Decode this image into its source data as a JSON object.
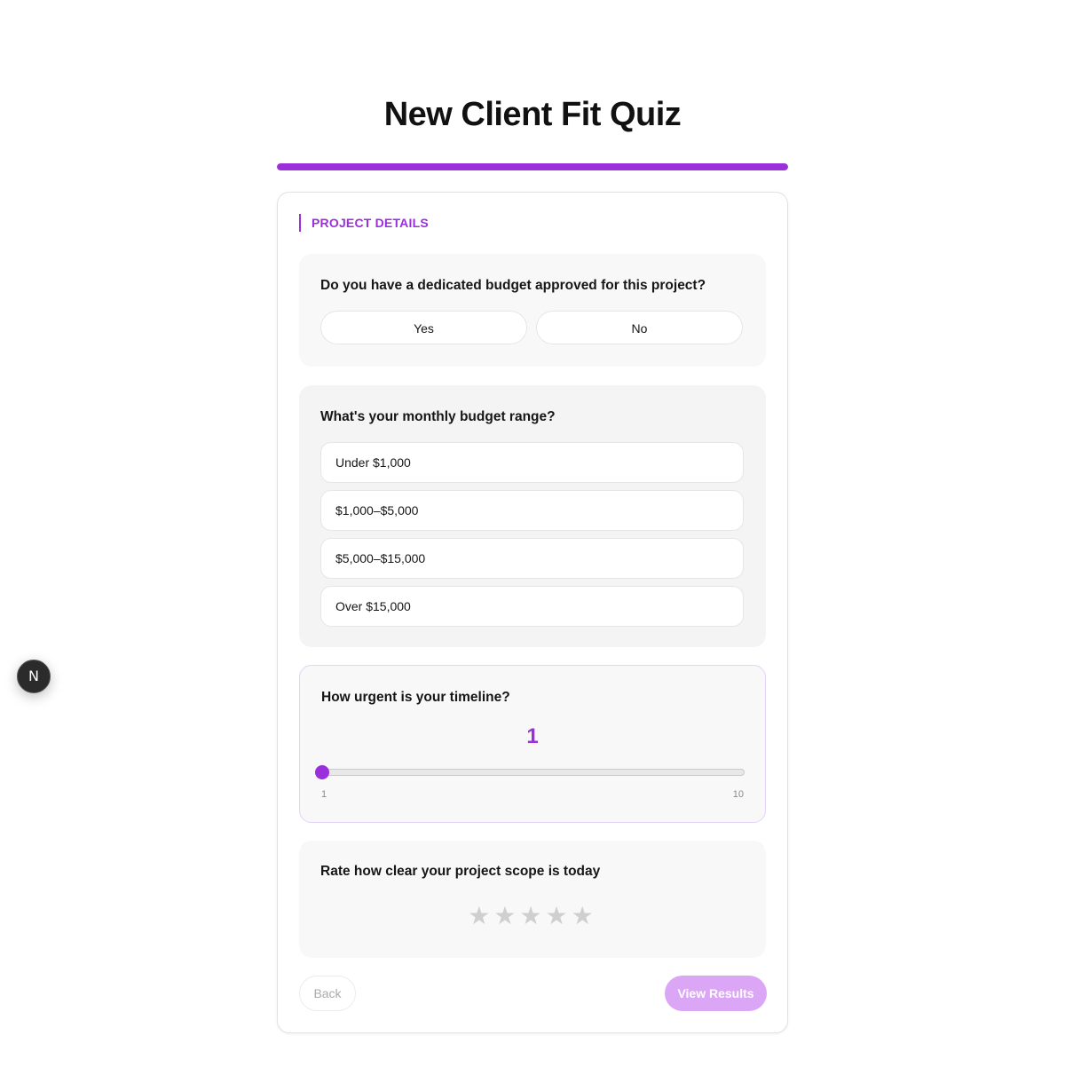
{
  "page": {
    "title": "New Client Fit Quiz",
    "progress_fraction": 1.0,
    "accent_color": "#9b2fdc"
  },
  "section": {
    "label": "PROJECT DETAILS"
  },
  "questions": {
    "budget_approved": {
      "text": "Do you have a dedicated budget approved for this project?",
      "options": [
        "Yes",
        "No"
      ]
    },
    "monthly_budget": {
      "text": "What's your monthly budget range?",
      "options": [
        "Under $1,000",
        "$1,000–$5,000",
        "$5,000–$15,000",
        "Over $15,000"
      ]
    },
    "urgency": {
      "text": "How urgent is your timeline?",
      "value": "1",
      "min": "1",
      "max": "10"
    },
    "scope_clarity": {
      "text": "Rate how clear your project scope is today",
      "rating": 0,
      "max_rating": 5,
      "star_glyph": "★"
    }
  },
  "footer": {
    "back_label": "Back",
    "results_label": "View Results"
  },
  "dev_badge": {
    "letter": "N",
    "icon": "nextjs-icon"
  }
}
